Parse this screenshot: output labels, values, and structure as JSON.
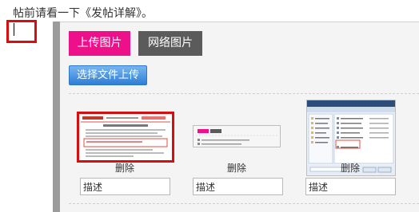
{
  "notice": "帖前请看一下《发帖详解》。",
  "tabs": {
    "upload": "上传图片",
    "web": "网络图片"
  },
  "choose_button": "选择文件上传",
  "images": [
    {
      "delete_label": "删除",
      "desc_value": "描述"
    },
    {
      "delete_label": "删除",
      "desc_value": "描述"
    },
    {
      "delete_label": "删除",
      "desc_value": "描述"
    }
  ],
  "colors": {
    "tab_active": "#ee0f8a",
    "tab_inactive": "#5b5b5b",
    "button": "#2e7dd6",
    "highlight": "#d80d0d"
  }
}
